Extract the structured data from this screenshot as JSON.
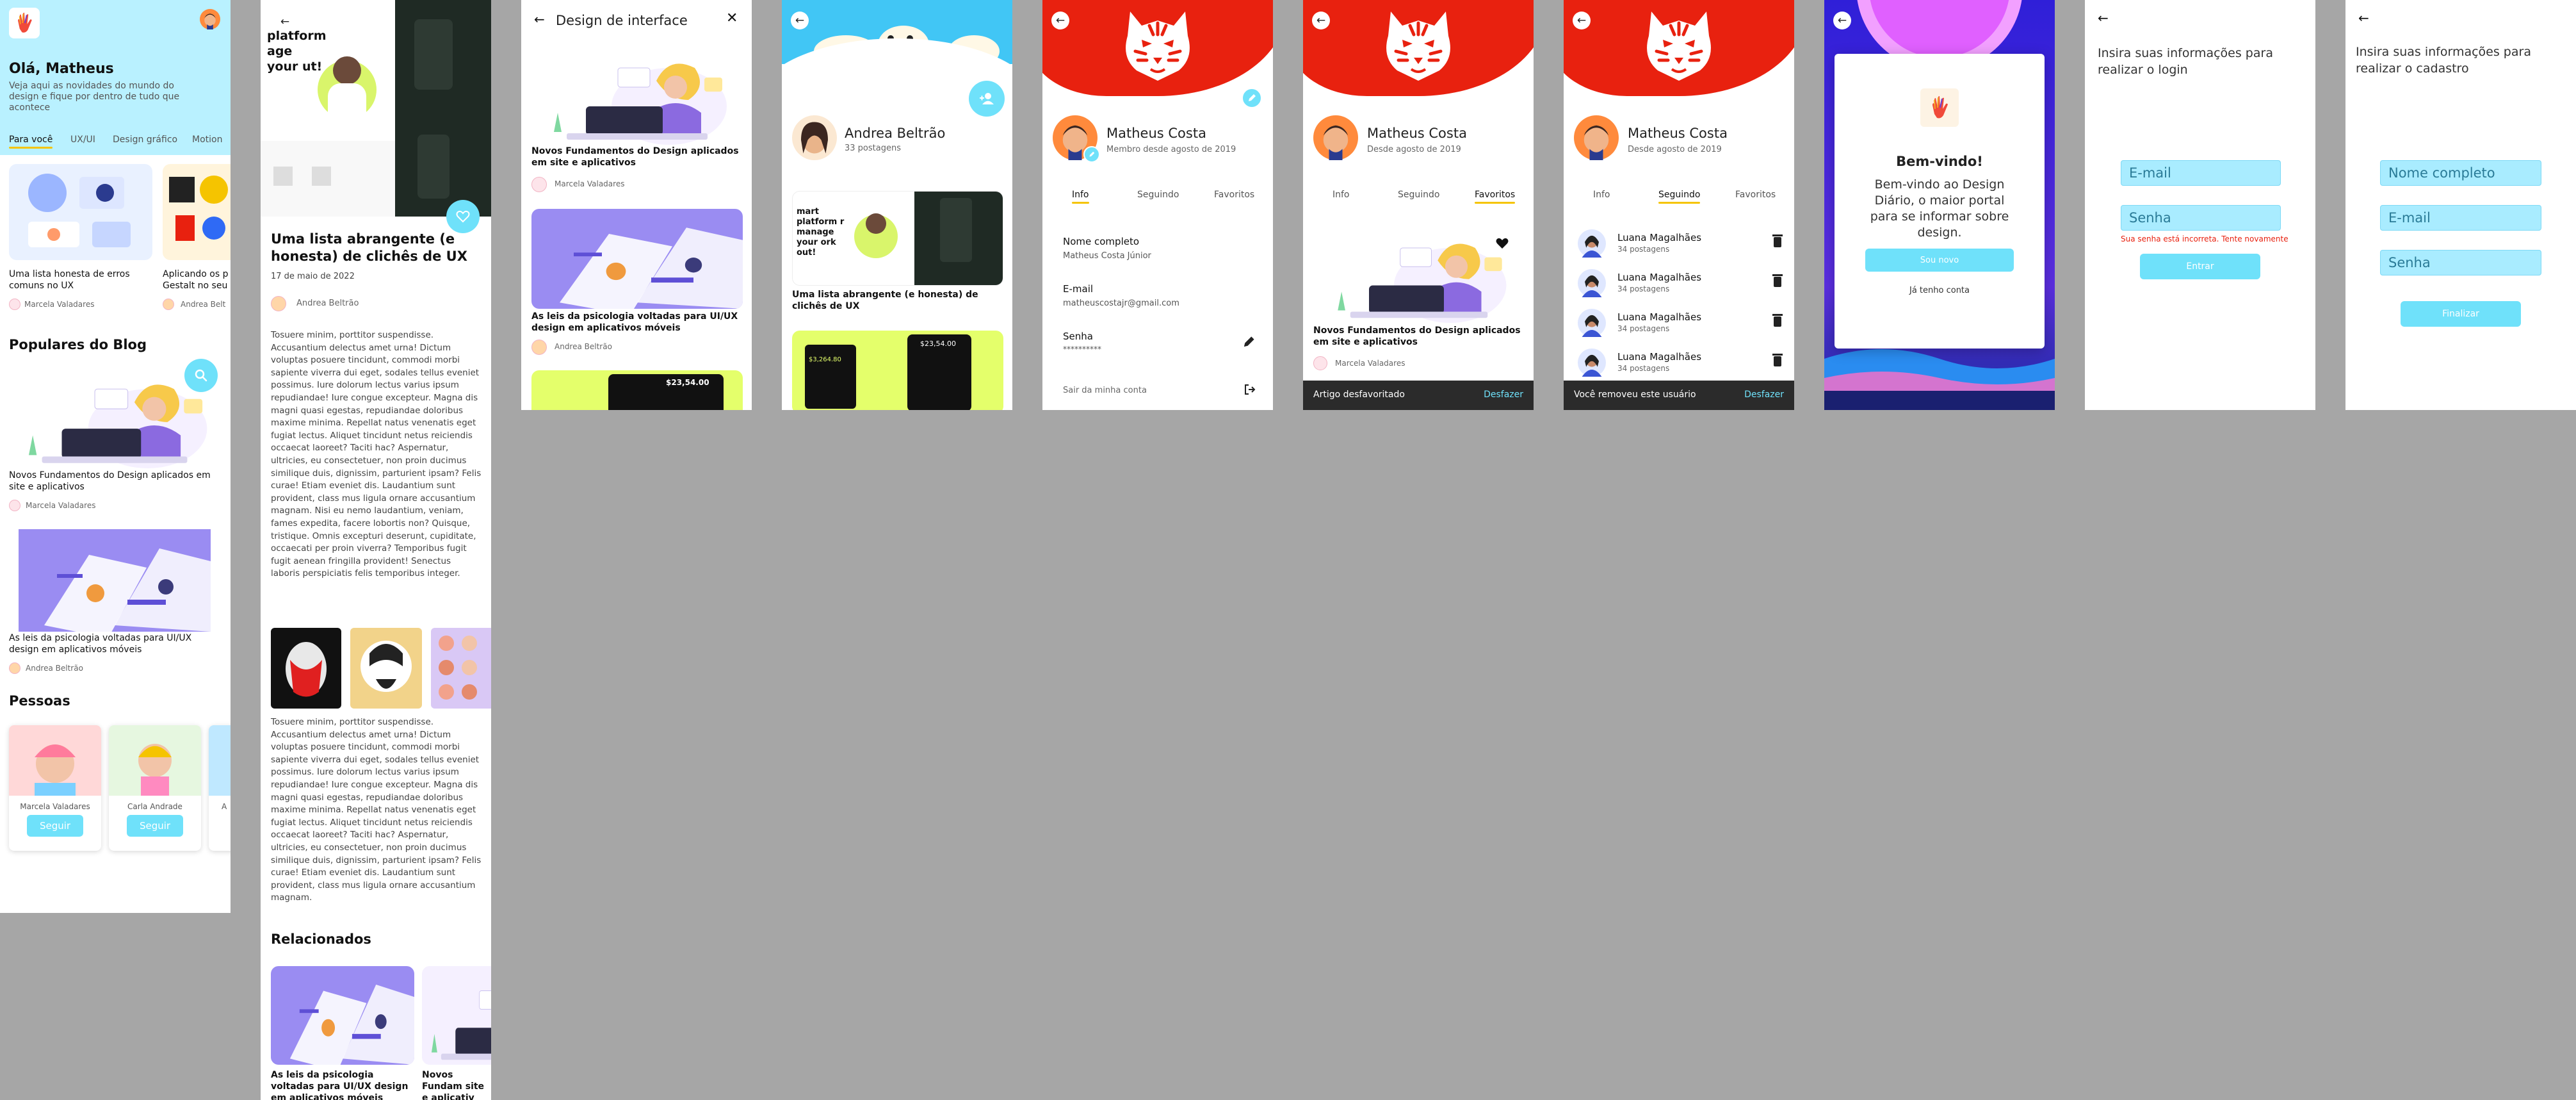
{
  "home": {
    "greeting": "Olá, Matheus",
    "subtitle": "Veja aqui as novidades do mundo do design e fique por dentro de tudo que acontece",
    "tabs": [
      "Para você",
      "UX/UI",
      "Design gráfico",
      "Motion"
    ],
    "card1_title": "Uma lista honesta de erros comuns no UX",
    "card1_author": "Marcela Valadares",
    "card2_title": "Aplicando os p Gestalt no seu",
    "card2_author": "Andrea Belt",
    "popular_heading": "Populares do Blog",
    "post1_title": "Novos Fundamentos do Design aplicados em site e aplicativos",
    "post1_author": "Marcela Valadares",
    "post2_title": "As leis da psicologia voltadas para UI/UX design em aplicativos móveis",
    "post2_author": "Andrea Beltrão",
    "people_heading": "Pessoas",
    "person1": "Marcela Valadares",
    "person2": "Carla Andrade",
    "person3": "A",
    "follow": "Seguir"
  },
  "article": {
    "title": "Uma lista abrangente (e honesta) de clichês de UX",
    "date": "17 de maio de 2022",
    "author": "Andrea Beltrão",
    "mock_text": "platform age your ut!",
    "body1": "Tosuere minim, porttitor suspendisse. Accusantium delectus amet urna! Dictum voluptas posuere tincidunt, commodi morbi sapiente viverra dui eget, sodales tellus eveniet possimus. Iure dolorum lectus varius ipsum repudiandae! Iure congue excepteur. Magna dis magni quasi egestas, repudiandae doloribus maxime minima. Repellat natus venenatis eget fugiat lectus. Aliquet tincidunt netus reiciendis occaecat laoreet? Taciti hac? Aspernatur, ultricies, eu consectetuer, non proin ducimus similique duis, dignissim, parturient ipsam? Felis curae! Etiam eveniet dis. Laudantium sunt provident, class mus ligula ornare accusantium magnam. Nisi eu nemo laudantium, veniam, fames expedita, facere lobortis non? Quisque, tristique. Omnis excepturi deserunt, cupiditate, occaecati per proin viverra? Temporibus fugit fugit aenean fringilla provident! Senectus laboris perspiciatis felis temporibus integer.",
    "body2": "Tosuere minim, porttitor suspendisse. Accusantium delectus amet urna! Dictum voluptas posuere tincidunt, commodi morbi sapiente viverra dui eget, sodales tellus eveniet possimus. Iure dolorum lectus varius ipsum repudiandae! Iure congue excepteur. Magna dis magni quasi egestas, repudiandae doloribus maxime minima. Repellat natus venenatis eget fugiat lectus. Aliquet tincidunt netus reiciendis occaecat laoreet? Taciti hac? Aspernatur, ultricies, eu consectetuer, non proin ducimus similique duis, dignissim, parturient ipsam? Felis curae! Etiam eveniet dis. Laudantium sunt provident, class mus ligula ornare accusantium magnam.",
    "related_heading": "Relacionados",
    "related1": "As leis da psicologia voltadas para UI/UX design em aplicativos móveis",
    "related2": "Novos Fundam site e aplicativ"
  },
  "category": {
    "title": "Design de interface",
    "post1_title": "Novos Fundamentos do Design aplicados em site e aplicativos",
    "post1_author": "Marcela Valadares",
    "post2_title": "As leis da psicologia voltadas para UI/UX design em aplicativos móveis",
    "post2_author": "Andrea Beltrão",
    "price": "$23,54.00"
  },
  "author_profile": {
    "name": "Andrea Beltrão",
    "posts": "33 postagens",
    "mock_text": "mart platform r manage your ork out!",
    "post_title": "Uma lista abrangente (e honesta) de clichês de UX",
    "price_a": "$23,54.00",
    "price_b": "$3,264.80"
  },
  "profile_info": {
    "name": "Matheus Costa",
    "since": "Membro desde agosto de 2019",
    "tabs": [
      "Info",
      "Seguindo",
      "Favoritos"
    ],
    "name_label": "Nome completo",
    "name_value": "Matheus Costa Júnior",
    "email_label": "E-mail",
    "email_value": "matheuscostajr@gmail.com",
    "pass_label": "Senha",
    "pass_value": "**********",
    "logout": "Sair da minha conta"
  },
  "profile_fav": {
    "name": "Matheus Costa",
    "since": "Desde agosto de 2019",
    "tabs": [
      "Info",
      "Seguindo",
      "Favoritos"
    ],
    "post_title": "Novos Fundamentos do Design aplicados em site e aplicativos",
    "post_author": "Marcela Valadares",
    "toast": "Artigo desfavoritado",
    "undo": "Desfazer"
  },
  "profile_follow": {
    "name": "Matheus Costa",
    "since": "Desde agosto de 2019",
    "tabs": [
      "Info",
      "Seguindo",
      "Favoritos"
    ],
    "user_name": "Luana Magalhães",
    "user_posts": "34 postagens",
    "toast": "Você removeu este usuário",
    "undo": "Desfazer"
  },
  "welcome": {
    "title": "Bem-vindo!",
    "text": "Bem-vindo ao Design Diário, o maior portal para se informar sobre design.",
    "new": "Sou novo",
    "have": "Já tenho conta"
  },
  "login": {
    "heading": "Insira suas informações para realizar o login",
    "email_ph": "E-mail",
    "pass_ph": "Senha",
    "error": "Sua senha está incorreta. Tente novamente",
    "submit": "Entrar"
  },
  "signup": {
    "heading": "Insira suas informações para realizar o cadastro",
    "name_ph": "Nome completo",
    "email_ph": "E-mail",
    "pass_ph": "Senha",
    "submit": "Finalizar"
  },
  "colors": {
    "cyan": "#6fe1fa",
    "red": "#e8210f",
    "yellow": "#f5c400",
    "dark": "#2b2b2b"
  }
}
